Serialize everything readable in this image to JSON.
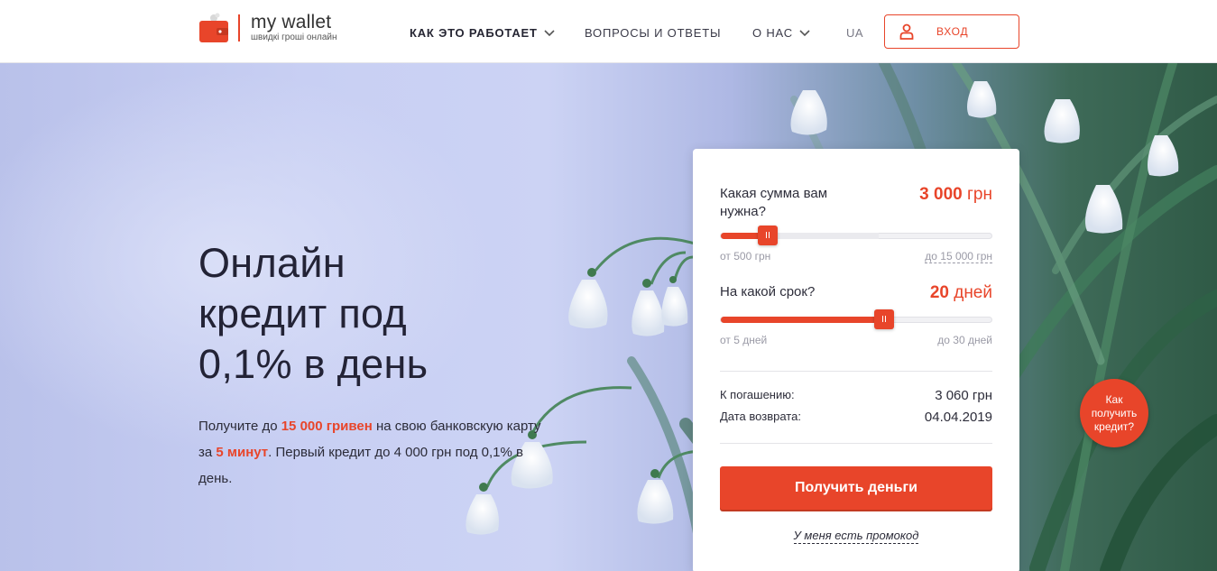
{
  "header": {
    "logo": {
      "name": "my wallet",
      "tagline": "швидкі гроші онлайн"
    },
    "nav": [
      {
        "label": "КАК ЭТО РАБОТАЕТ",
        "has_dropdown": true
      },
      {
        "label": "ВОПРОСЫ И ОТВЕТЫ",
        "has_dropdown": false
      },
      {
        "label": "О НАС",
        "has_dropdown": true
      }
    ],
    "lang": "UA",
    "login_label": "ВХОД",
    "login_icon": "user-icon"
  },
  "hero": {
    "headline": [
      "Онлайн",
      "кредит под",
      "0,1% в день"
    ],
    "sub": {
      "p1": "Получите до ",
      "h1": "15 000 гривен",
      "p2": " на свою банковскую карту за ",
      "h2": "5 минут",
      "p3": ". Первый кредит до 4 000 грн под 0,1% в день."
    }
  },
  "calculator": {
    "amount": {
      "question": "Какая сумма вам нужна?",
      "value_num": "3 000",
      "value_unit": " грн",
      "min_label": "от 500 грн",
      "max_label": "до 15 000 грн",
      "min": 500,
      "max": 15000,
      "current": 3000
    },
    "term": {
      "question": "На какой срок?",
      "value_num": "20",
      "value_unit": " дней",
      "min_label": "от 5 дней",
      "max_label": "до 30 дней",
      "min": 5,
      "max": 30,
      "current": 20
    },
    "summary": {
      "repay_label": "К погашению:",
      "repay_value": "3 060 грн",
      "date_label": "Дата возврата:",
      "date_value": "04.04.2019"
    },
    "cta_label": "Получить деньги",
    "promo_label": "У меня есть промокод"
  },
  "help_bubble": "Как получить кредит?",
  "colors": {
    "accent": "#e8452a",
    "text": "#2d2d3a"
  }
}
